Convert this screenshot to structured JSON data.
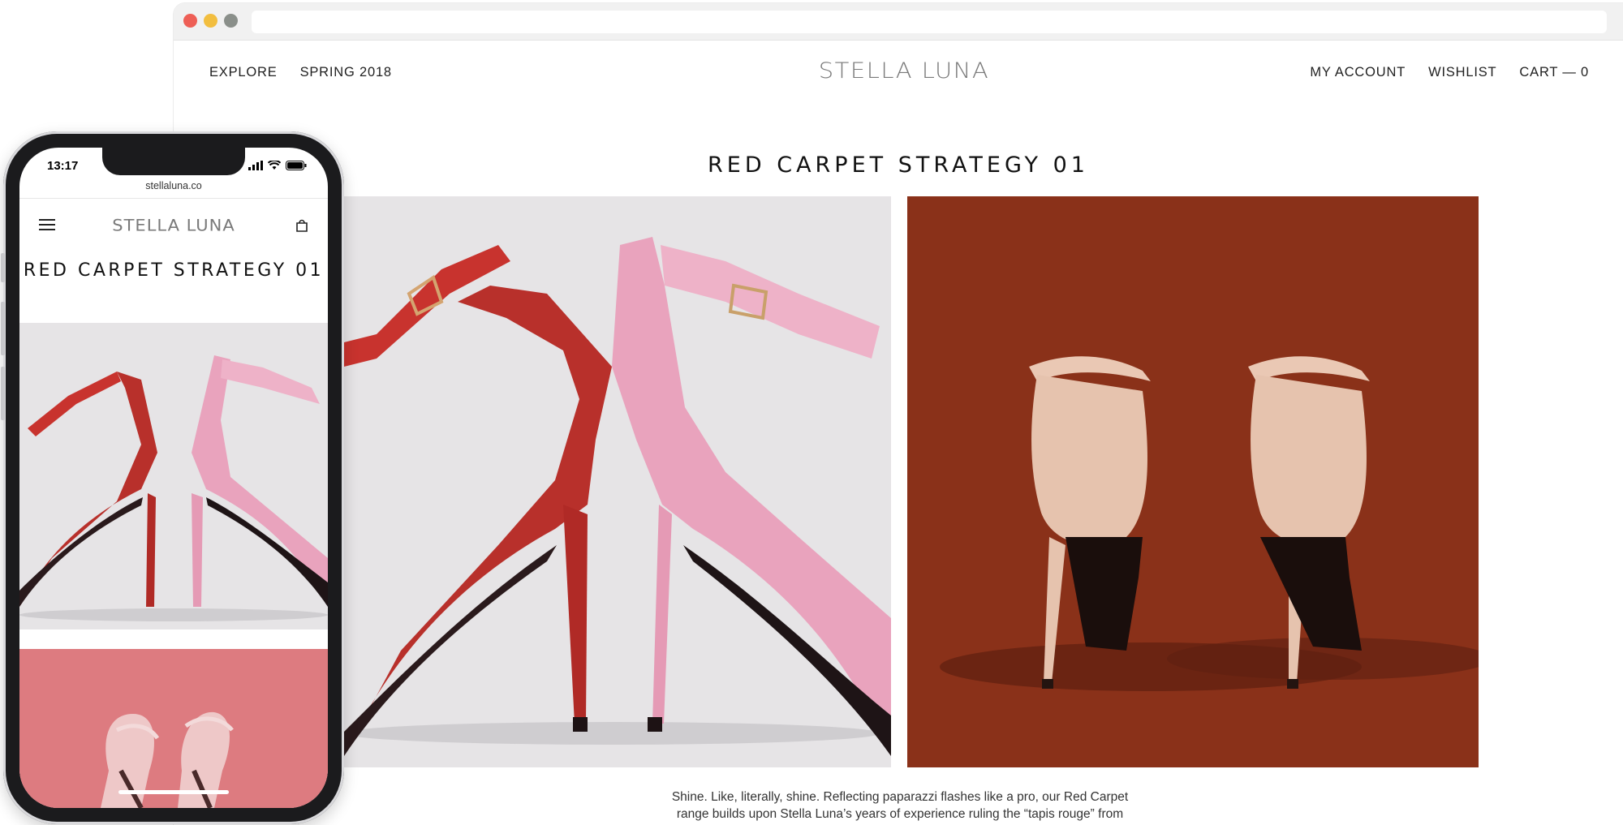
{
  "browser": {
    "nav_left": [
      "EXPLORE",
      "SPRING 2018"
    ],
    "logo": "STELLA LUNA",
    "nav_right": [
      "MY ACCOUNT",
      "WISHLIST",
      "CART — 0"
    ]
  },
  "page": {
    "title": "RED CARPET STRATEGY 01",
    "body_lines": [
      "Shine. Like, literally, shine. Reflecting paparazzi flashes like a pro, our Red Carpet",
      "range builds upon Stella Luna’s years of experience ruling the “tapis rouge” from"
    ]
  },
  "phone": {
    "time": "13:17",
    "url": "stellaluna.co",
    "logo": "STELLA LUNA",
    "title": "RED CARPET STRATEGY 01"
  },
  "colors": {
    "hero_left_bg": "#e6e4e6",
    "hero_right_bg": "#8a3119",
    "mobile_second_bg": "#dd7b80",
    "shoe_red": "#b8302b",
    "shoe_pink": "#e9a3bd",
    "shoe_nude": "#e6c3ae"
  },
  "icons": {
    "menu": "hamburger-icon",
    "cart": "bag-icon",
    "wifi": "wifi-icon",
    "battery": "battery-icon",
    "signal": "signal-icon"
  }
}
